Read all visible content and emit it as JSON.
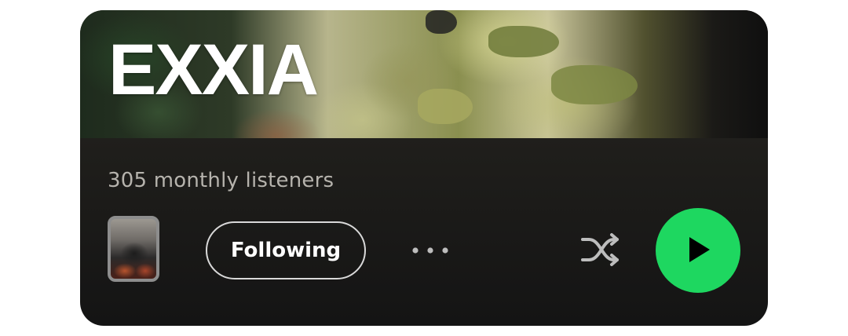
{
  "artist": {
    "name": "EXXIA",
    "monthly_listeners": "305 monthly listeners"
  },
  "controls": {
    "follow_label": "Following"
  },
  "icons": {
    "more": "more-horizontal-icon",
    "shuffle": "shuffle-icon",
    "play": "play-icon"
  },
  "colors": {
    "accent": "#1ed760",
    "card_background": "#1c1b19",
    "primary_text": "#ffffff",
    "secondary_text": "#b6b3ad"
  }
}
